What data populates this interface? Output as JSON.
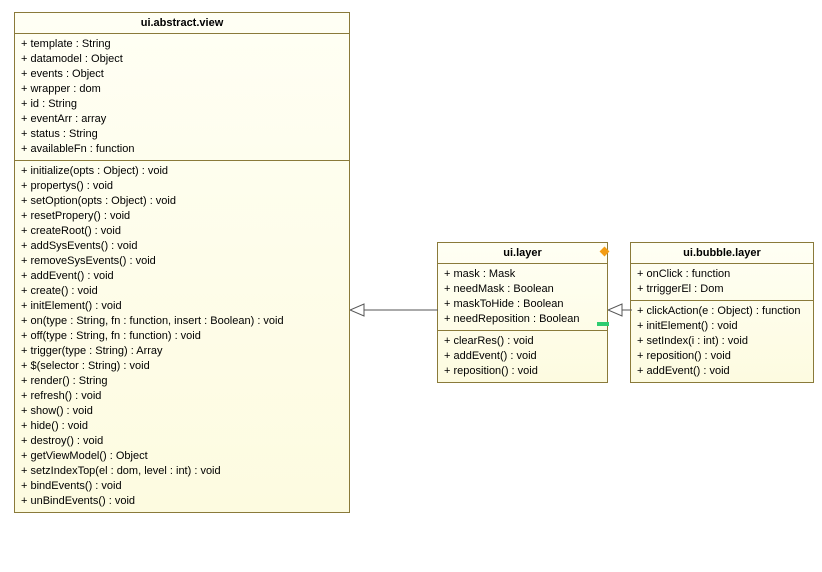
{
  "classes": {
    "abstract_view": {
      "title": "ui.abstract.view",
      "attrs": [
        "+ template : String",
        "+ datamodel : Object",
        "+ events : Object",
        "+ wrapper : dom",
        "+ id : String",
        "+ eventArr : array",
        "+ status : String",
        "+ availableFn : function"
      ],
      "ops": [
        "+ initialize(opts : Object) : void",
        "+ propertys() : void",
        "+ setOption(opts : Object) : void",
        "+ resetPropery() : void",
        "+ createRoot() : void",
        "+ addSysEvents() : void",
        "+ removeSysEvents() : void",
        "+ addEvent() : void",
        "+ create() : void",
        "+ initElement() : void",
        "+ on(type : String, fn : function, insert : Boolean) : void",
        "+ off(type : String, fn : function) : void",
        "+ trigger(type : String) : Array",
        "+ $(selector : String) : void",
        "+ render() : String",
        "+ refresh() : void",
        "+ show() : void",
        "+ hide() : void",
        "+ destroy() : void",
        "+ getViewModel() : Object",
        "+ setzIndexTop(el : dom, level : int) : void",
        "+ bindEvents() : void",
        "+ unBindEvents() : void"
      ]
    },
    "layer": {
      "title": "ui.layer",
      "attrs": [
        "+ mask : Mask",
        "+ needMask : Boolean",
        "+ maskToHide : Boolean",
        "+ needReposition : Boolean"
      ],
      "ops": [
        "+ clearRes() : void",
        "+ addEvent() : void",
        "+ reposition() : void"
      ]
    },
    "bubble_layer": {
      "title": "ui.bubble.layer",
      "attrs": [
        "+ onClick : function",
        "+ trriggerEl : Dom"
      ],
      "ops": [
        "+ clickAction(e : Object) : function",
        "+ initElement() : void",
        "+ setIndex(i : int) : void",
        "+ reposition() : void",
        "+ addEvent() : void"
      ]
    }
  }
}
